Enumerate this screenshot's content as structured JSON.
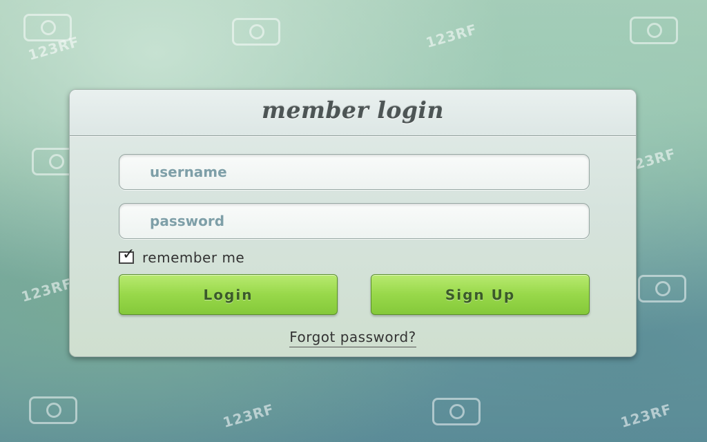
{
  "watermark": {
    "text": "123RF",
    "icon": "camera-icon"
  },
  "login_panel": {
    "title": "member login",
    "username_placeholder": "username",
    "password_placeholder": "password",
    "remember_label": "remember me",
    "remember_checked": true,
    "login_label": "Login",
    "signup_label": "Sign Up",
    "forgot_label": "Forgot password?"
  },
  "colors": {
    "button_green": "#98d84a",
    "panel_bg": "#d6e3dd",
    "title_text": "#4d5555",
    "placeholder_text": "#7e9fa8"
  }
}
